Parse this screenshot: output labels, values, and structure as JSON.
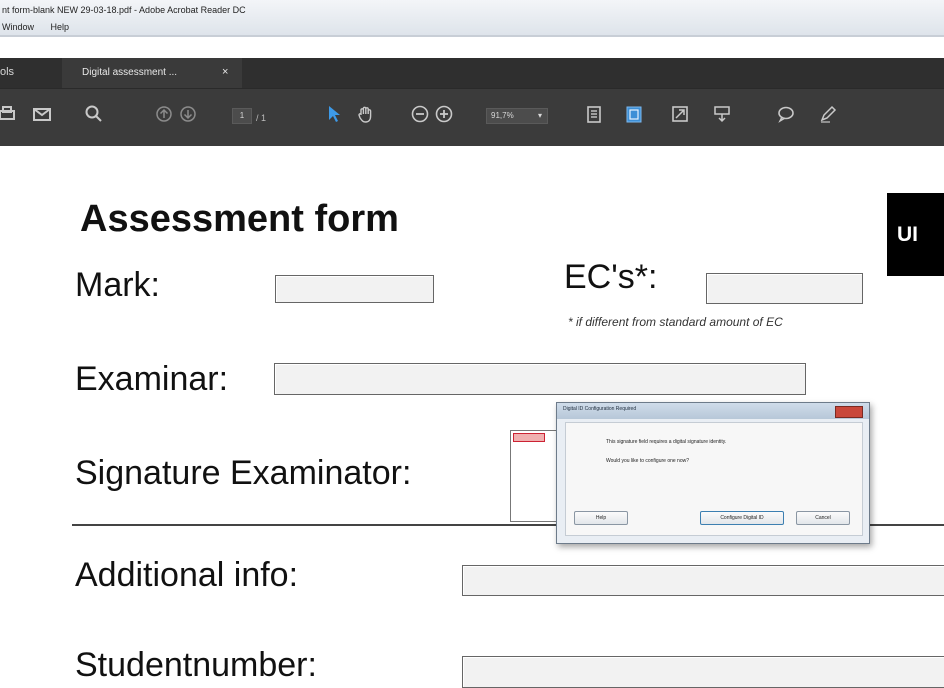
{
  "window": {
    "title": "nt form-blank NEW 29-03-18.pdf - Adobe Acrobat Reader DC",
    "menus": [
      "Window",
      "Help"
    ]
  },
  "tabs": {
    "tools": "ols",
    "document": "Digital assessment ...",
    "close_glyph": "×"
  },
  "toolbar": {
    "page_current": "1",
    "page_total": "/ 1",
    "zoom": "91,7%",
    "zoom_caret": "▾"
  },
  "form": {
    "title": "Assessment form",
    "mark_label": "Mark:",
    "ecs_label": "EC's*:",
    "ecs_note": "* if different from standard amount of EC",
    "examinar_label": "Examinar:",
    "signature_label": "Signature Examinator:",
    "additional_label": "Additional info:",
    "studentnumber_label": "Studentnumber:",
    "logo_text": "UI"
  },
  "dialog": {
    "title": "Digital ID Configuration Required",
    "message1": "This signature field requires a digital signature identity.",
    "message2": "Would you like to configure one now?",
    "help_button": "Help",
    "configure_button": "Configure Digital ID",
    "cancel_button": "Cancel"
  }
}
